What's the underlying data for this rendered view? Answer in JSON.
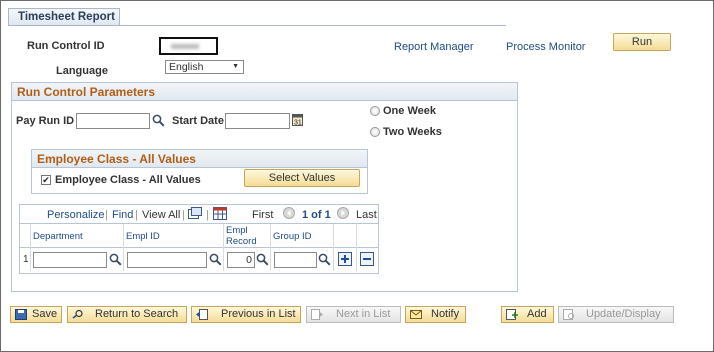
{
  "tab": {
    "label": "Timesheet Report"
  },
  "run_control": {
    "label": "Run Control ID"
  },
  "links": {
    "report_manager": "Report Manager",
    "process_monitor": "Process Monitor"
  },
  "run_button": {
    "label": "Run"
  },
  "language": {
    "label": "Language",
    "value": "English"
  },
  "params": {
    "title": "Run Control Parameters",
    "pay_run_id_label": "Pay Run ID",
    "start_date_label": "Start Date",
    "one_week_label": "One Week",
    "two_weeks_label": "Two Weeks"
  },
  "employee_class": {
    "title": "Employee Class - All Values",
    "checkbox_label": "Employee Class - All Values",
    "checked": true,
    "select_values_label": "Select Values"
  },
  "grid": {
    "personalize": "Personalize",
    "find": "Find",
    "view_all": "View All",
    "first": "First",
    "page_info": "1 of 1",
    "last": "Last",
    "headers": {
      "department": "Department",
      "empl_id": "Empl ID",
      "empl_record_1": "Empl",
      "empl_record_2": "Record",
      "group_id": "Group ID"
    },
    "row": {
      "number": "1",
      "empl_record_value": "0"
    }
  },
  "toolbar": {
    "save": "Save",
    "return_to_search": "Return to Search",
    "previous_in_list": "Previous in List",
    "next_in_list": "Next in List",
    "notify": "Notify",
    "add": "Add",
    "update_display": "Update/Display"
  },
  "colors": {
    "accent_orange": "#b05e17",
    "link_blue": "#214c88",
    "button_gold": "#f3dc95"
  }
}
